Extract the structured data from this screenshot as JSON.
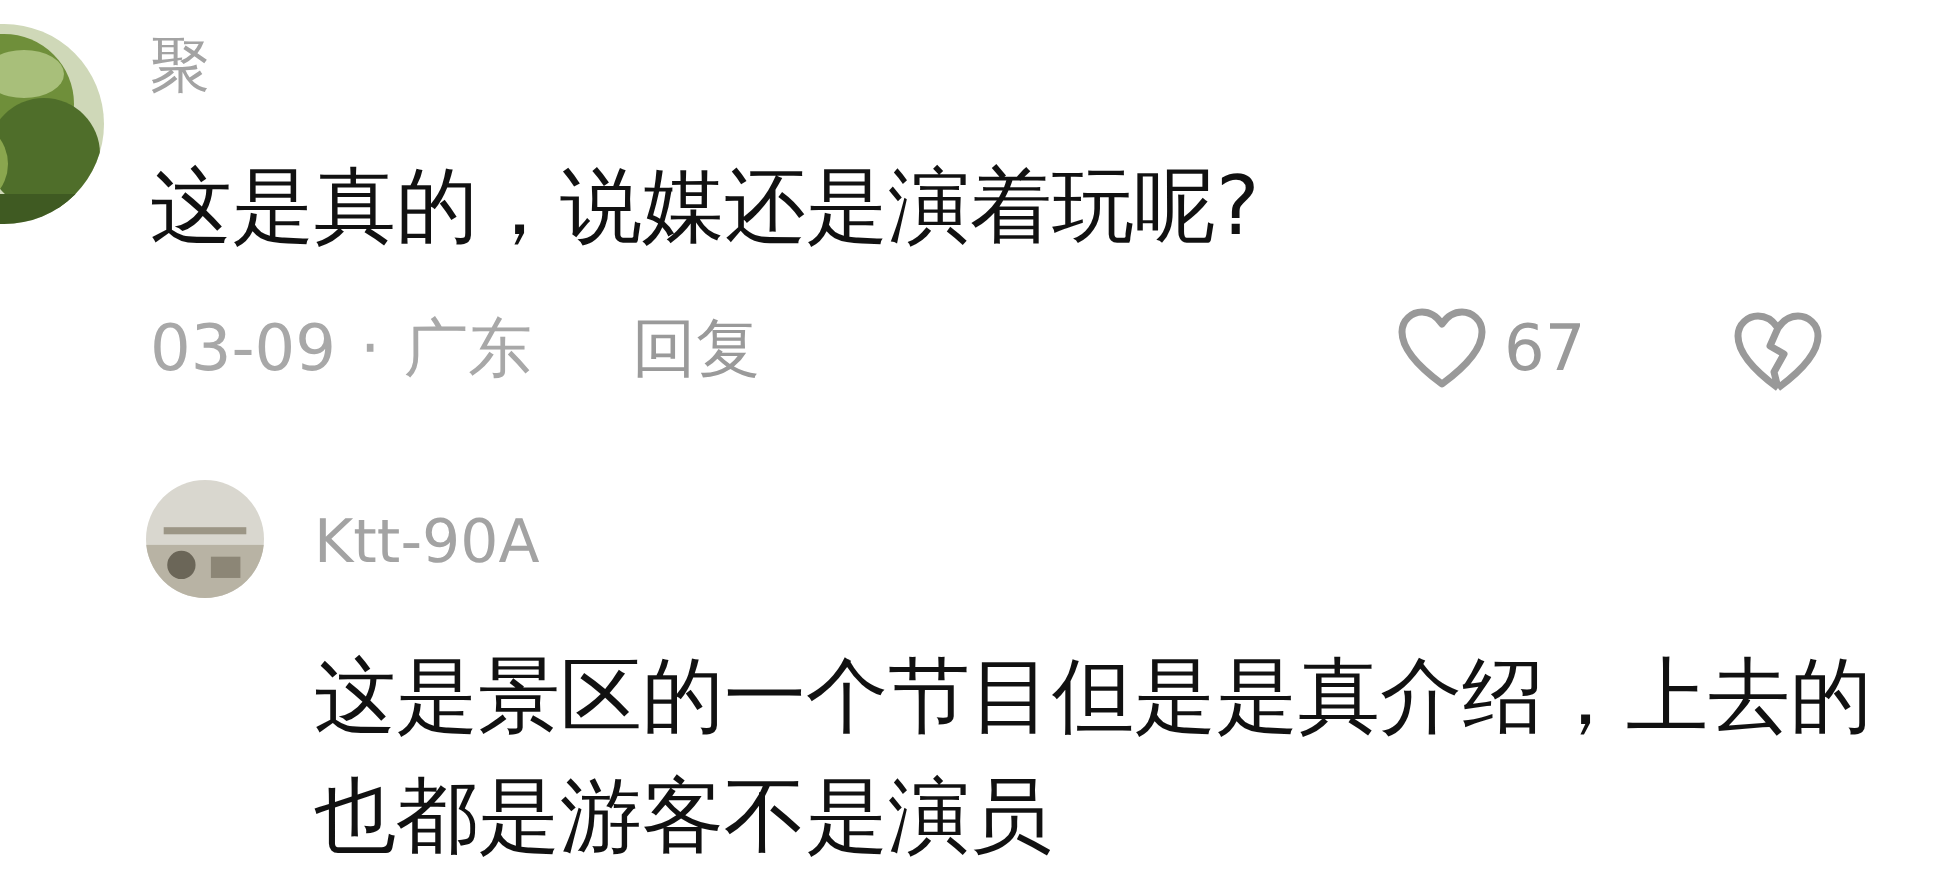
{
  "comment": {
    "name": "聚",
    "text": "这是真的，说媒还是演着玩呢?",
    "date": "03-09",
    "separator": "·",
    "location": "广东",
    "reply_label": "回复",
    "likes": "67"
  },
  "reply": {
    "name": "Ktt-90A",
    "text": "这是景区的一个节目但是是真介绍，上去的也都是游客不是演员"
  }
}
